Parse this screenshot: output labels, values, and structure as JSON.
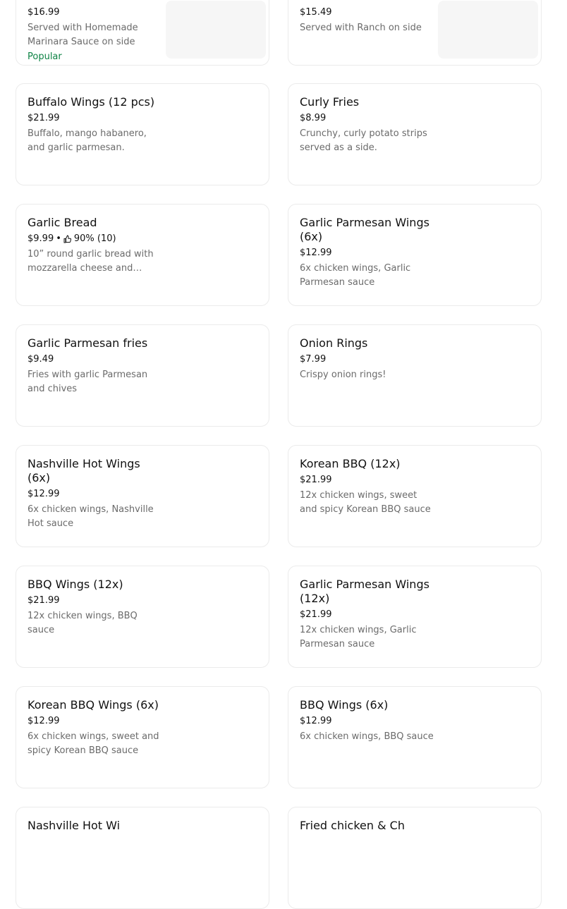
{
  "items": [
    {
      "price": "$16.99",
      "desc": "Served with Homemade Marinara Sauce on side",
      "badge": "Popular"
    },
    {
      "price": "$15.49",
      "desc": "Served with Ranch on side"
    },
    {
      "title": "Buffalo Wings (12 pcs)",
      "price": "$21.99",
      "desc": "Buffalo, mango habanero, and garlic parmesan."
    },
    {
      "title": "Curly Fries",
      "price": "$8.99",
      "desc": "Crunchy, curly potato strips served as a side."
    },
    {
      "title": "Garlic Bread",
      "price": "$9.99",
      "rating": "90% (10)",
      "desc": "10” round garlic bread with mozzarella cheese and…"
    },
    {
      "title": "Garlic Parmesan Wings (6x)",
      "price": "$12.99",
      "desc": "6x chicken wings, Garlic Parmesan sauce"
    },
    {
      "title": "Garlic Parmesan fries",
      "price": "$9.49",
      "desc": "Fries with garlic Parmesan and chives"
    },
    {
      "title": "Onion Rings",
      "price": "$7.99",
      "desc": "Crispy onion rings!"
    },
    {
      "title": "Nashville Hot Wings (6x)",
      "price": "$12.99",
      "desc": "6x chicken wings, Nashville Hot sauce"
    },
    {
      "title": "Korean BBQ (12x)",
      "price": "$21.99",
      "desc": "12x chicken wings, sweet and spicy Korean BBQ sauce"
    },
    {
      "title": "BBQ Wings (12x)",
      "price": "$21.99",
      "desc": "12x chicken wings, BBQ sauce"
    },
    {
      "title": "Garlic Parmesan Wings (12x)",
      "price": "$21.99",
      "desc": "12x chicken wings, Garlic Parmesan sauce"
    },
    {
      "title": "Korean BBQ Wings (6x)",
      "price": "$12.99",
      "desc": "6x chicken wings, sweet and spicy Korean BBQ sauce"
    },
    {
      "title": "BBQ Wings (6x)",
      "price": "$12.99",
      "desc": "6x chicken wings, BBQ sauce"
    }
  ],
  "partial": [
    {
      "title": "Nashville Hot Wi"
    },
    {
      "title": "Fried chicken & Ch"
    }
  ],
  "separator": "•",
  "icons": {
    "rating": "thumbs-up-icon"
  },
  "colors": {
    "popular": "#0e8345",
    "muted": "#6b6b6b"
  }
}
